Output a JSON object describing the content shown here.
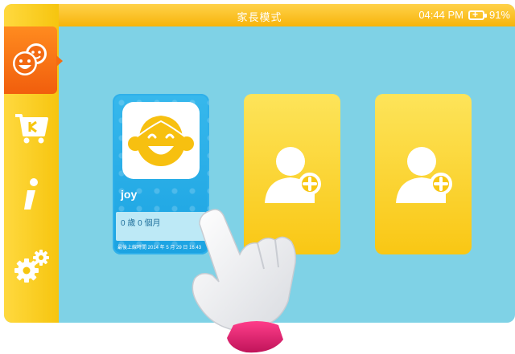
{
  "header": {
    "title": "家長模式",
    "time": "04:44 PM",
    "battery": "91%"
  },
  "sidebar": {
    "items": [
      {
        "name": "kids-icon",
        "active": true
      },
      {
        "name": "store-cart-icon",
        "active": false
      },
      {
        "name": "info-icon",
        "active": false
      },
      {
        "name": "settings-gears-icon",
        "active": false
      }
    ]
  },
  "profiles": {
    "child": {
      "name": "joy",
      "age": "0 歲 0 個月",
      "last_login": "最後上線時間 2014 年 5 月 29 日 16:43"
    }
  },
  "colors": {
    "background": "#7fd2e6",
    "sidebar": "#f6c50f",
    "active": "#f15e0d",
    "child_card": "#1ba3e2",
    "empty_card": "#f9c714"
  }
}
